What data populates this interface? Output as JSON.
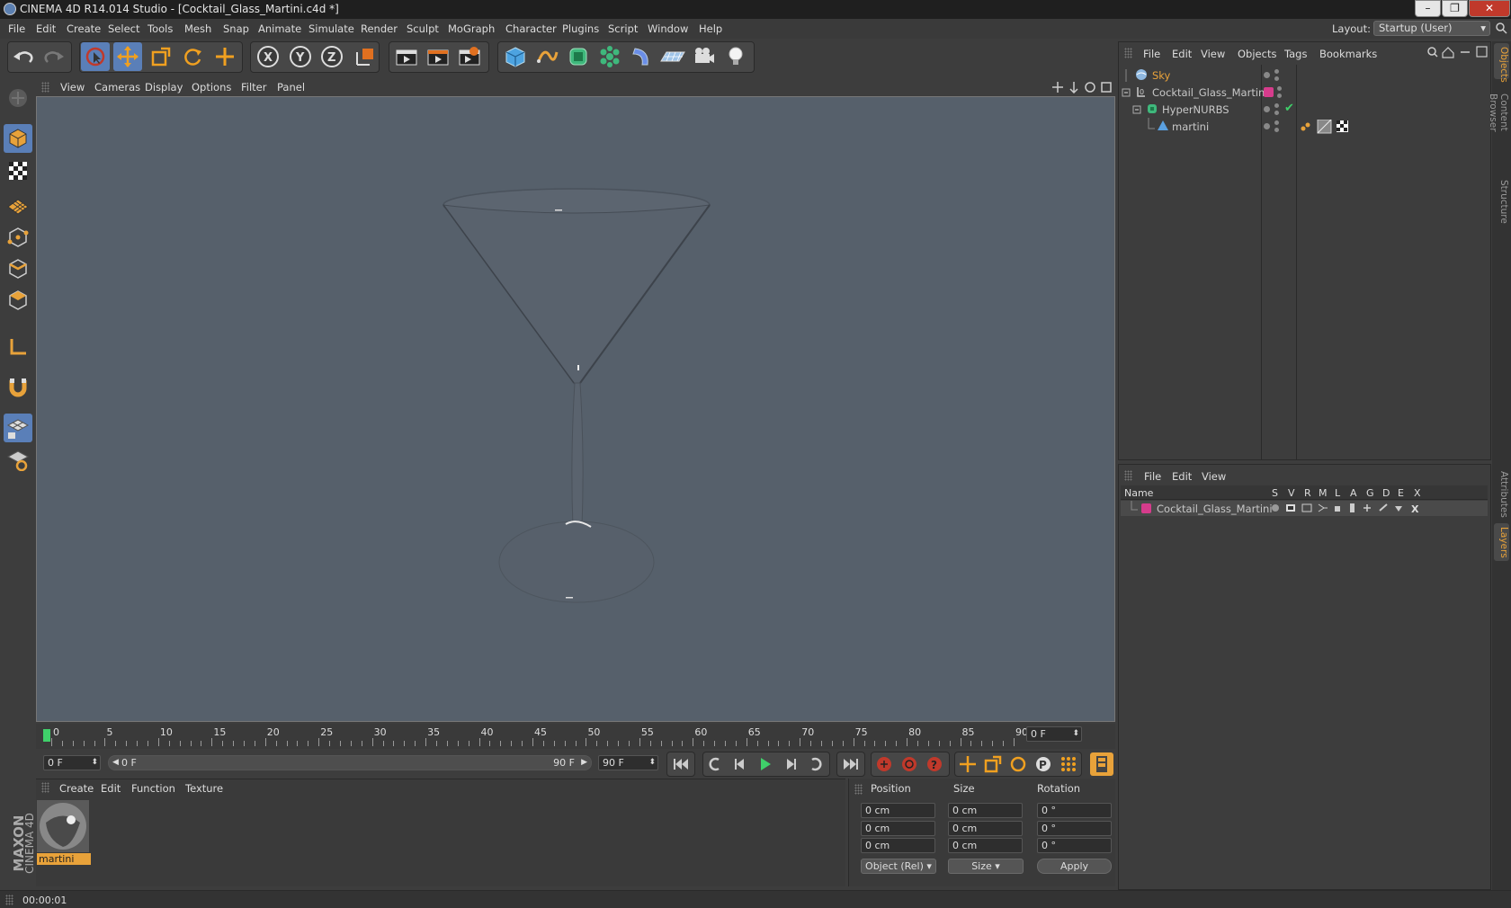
{
  "window": {
    "title": "CINEMA 4D R14.014 Studio - [Cocktail_Glass_Martini.c4d *]",
    "buttons": {
      "minimize": "–",
      "maximize": "❐",
      "close": "✕"
    }
  },
  "menu": [
    "File",
    "Edit",
    "Create",
    "Select",
    "Tools",
    "Mesh",
    "Snap",
    "Animate",
    "Simulate",
    "Render",
    "Sculpt",
    "MoGraph",
    "Character",
    "Plugins",
    "Script",
    "Window",
    "Help"
  ],
  "layout": {
    "label": "Layout:",
    "value": "Startup (User)"
  },
  "viewport_menu": [
    "View",
    "Cameras",
    "Display",
    "Options",
    "Filter",
    "Panel"
  ],
  "timeline": {
    "ticks": [
      "0",
      "5",
      "10",
      "15",
      "20",
      "25",
      "30",
      "35",
      "40",
      "45",
      "50",
      "55",
      "60",
      "65",
      "70",
      "75",
      "80",
      "85",
      "90"
    ],
    "end_field": "0 F"
  },
  "transport": {
    "start_field": "0 F",
    "range_start": "0 F",
    "range_end": "90 F",
    "end_field": "90 F"
  },
  "material_menu": [
    "Create",
    "Edit",
    "Function",
    "Texture"
  ],
  "material": {
    "name": "martini"
  },
  "coordinates": {
    "headers": [
      "Position",
      "Size",
      "Rotation"
    ],
    "position": {
      "x": "0 cm",
      "y": "0 cm",
      "z": "0 cm"
    },
    "size": {
      "x": "0 cm",
      "y": "0 cm",
      "z": "0 cm"
    },
    "rotation": {
      "h": "0 °",
      "p": "0 °",
      "b": "0 °"
    },
    "mode": "Object (Rel)",
    "size_mode": "Size",
    "apply": "Apply"
  },
  "objects_menu": [
    "File",
    "Edit",
    "View",
    "Objects",
    "Tags",
    "Bookmarks"
  ],
  "objects": [
    {
      "name": "Sky",
      "color": "#e8a23a"
    },
    {
      "name": "Cocktail_Glass_Martini",
      "color": "#c8c8c8"
    },
    {
      "name": "HyperNURBS",
      "color": "#c8c8c8"
    },
    {
      "name": "martini",
      "color": "#c8c8c8"
    }
  ],
  "layers_menu": [
    "File",
    "Edit",
    "View"
  ],
  "layers_columns": [
    "Name",
    "S",
    "V",
    "R",
    "M",
    "L",
    "A",
    "G",
    "D",
    "E",
    "X"
  ],
  "layers": [
    {
      "name": "Cocktail_Glass_Martini",
      "color": "#d63c8c"
    }
  ],
  "right_tabs": [
    "Objects",
    "Content Browser",
    "Structure",
    "Attributes",
    "Layers"
  ],
  "status": "00:00:01",
  "brand": {
    "line1": "MAXON",
    "line2": "CINEMA 4D"
  },
  "colors": {
    "accent": "#e8a23a",
    "selection": "#5a7fb8",
    "viewport": "#56606b"
  }
}
